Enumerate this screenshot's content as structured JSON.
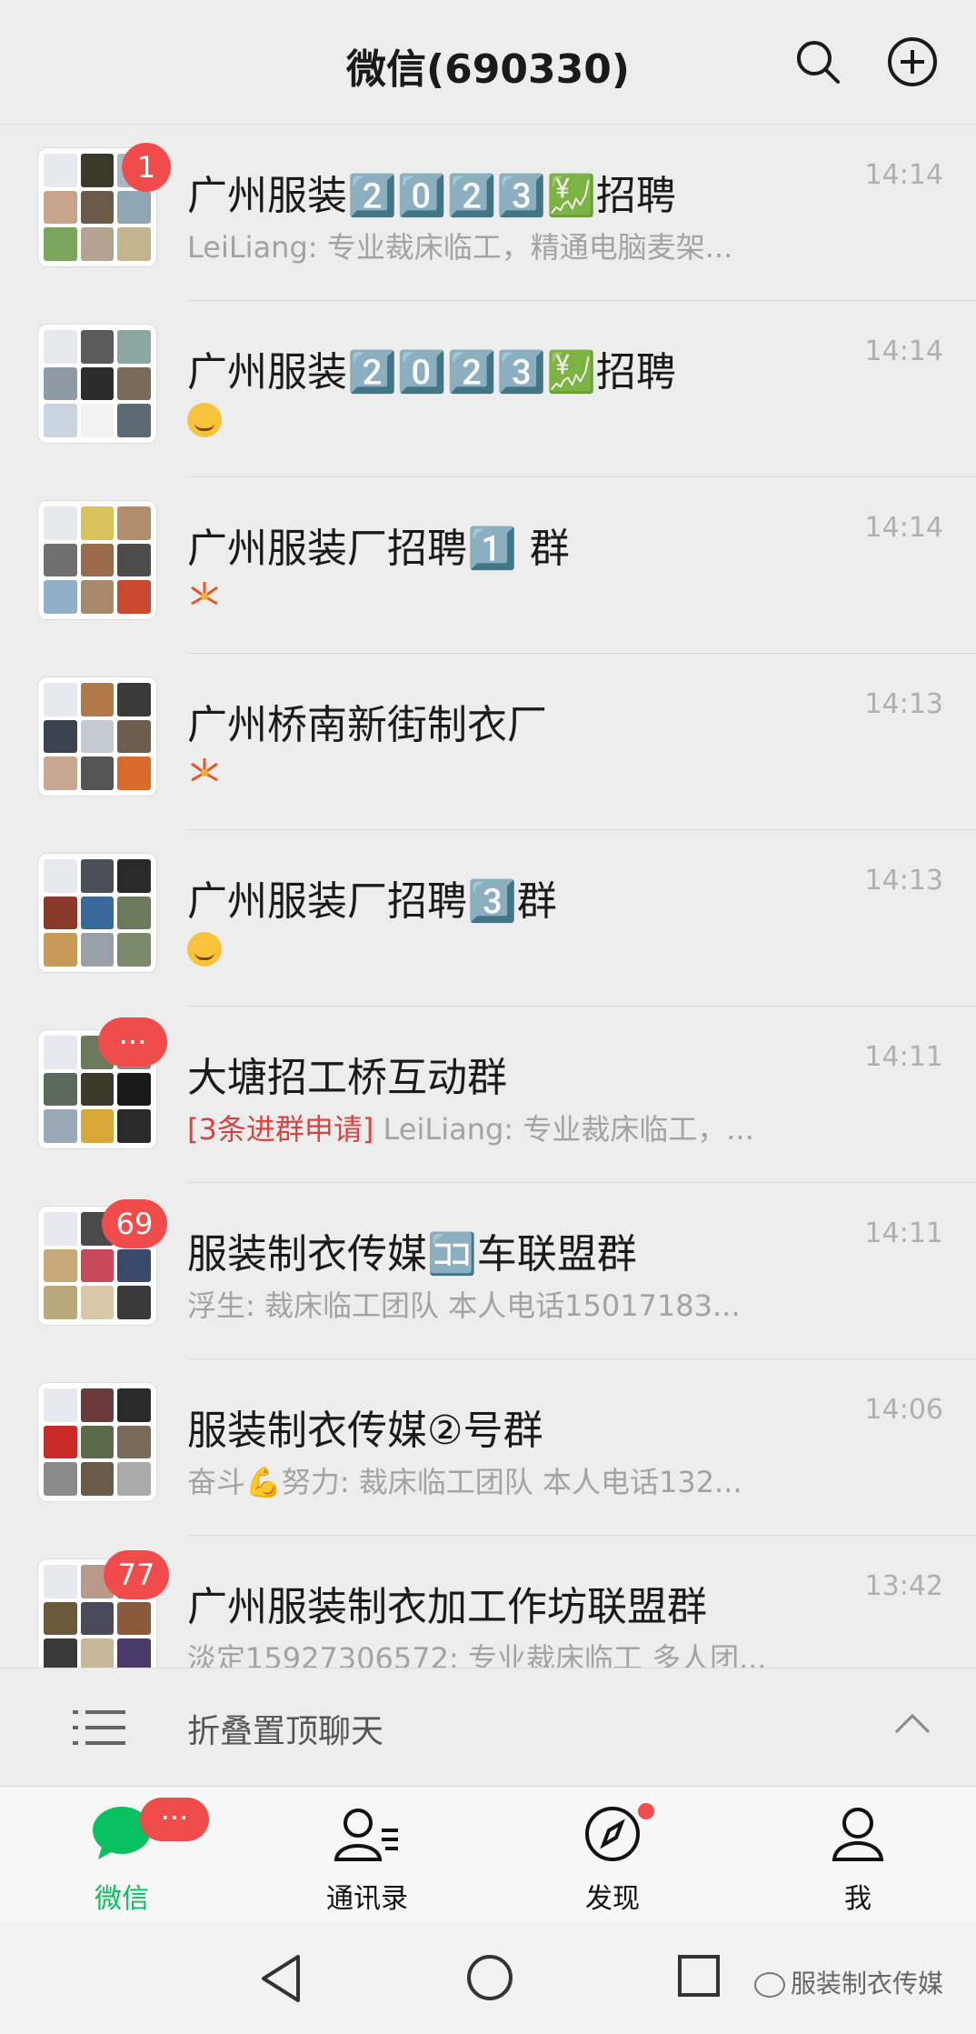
{
  "header": {
    "title": "微信(690330)"
  },
  "chats": [
    {
      "name": "广州服装2️⃣0️⃣2️⃣3️⃣💹招聘",
      "time": "14:14",
      "preview": "LeiLiang: 专业裁床临工，精通电脑麦架...",
      "badge": "1"
    },
    {
      "name": "广州服装2️⃣0️⃣2️⃣3️⃣💹招聘",
      "time": "14:14",
      "preview": "",
      "badge": ""
    },
    {
      "name": "广州服装厂招聘1️⃣ 群",
      "time": "14:14",
      "preview": "",
      "badge": ""
    },
    {
      "name": "广州桥南新街制衣厂",
      "time": "14:13",
      "preview": "",
      "badge": ""
    },
    {
      "name": "广州服装厂招聘3️⃣群",
      "time": "14:13",
      "preview": "",
      "badge": ""
    },
    {
      "name": "大塘招工桥互动群",
      "time": "14:11",
      "preview_warn": "[3条进群申请]",
      "preview": " LeiLiang: 专业裁床临工，...",
      "badge": "···"
    },
    {
      "name": "服装制衣传媒🈁车联盟群",
      "time": "14:11",
      "preview": "浮生: 裁床临工团队 本人电话15017183...",
      "badge": "69"
    },
    {
      "name": "服装制衣传媒②号群",
      "time": "14:06",
      "preview": "奋斗💪努力: 裁床临工团队 本人电话132...",
      "badge": ""
    },
    {
      "name": "广州服装制衣加工作坊联盟群",
      "time": "13:42",
      "preview": "淡定15927306572: 专业裁床临工 多人团...",
      "badge": "77"
    }
  ],
  "folder": {
    "label": "折叠置顶聊天"
  },
  "tabs": [
    {
      "label": "微信",
      "badge": "···"
    },
    {
      "label": "通讯录"
    },
    {
      "label": "发现"
    },
    {
      "label": "我"
    }
  ],
  "watermark": "服装制衣传媒",
  "colors": {
    "accent": "#07c160",
    "badge": "#f14c4c",
    "warn": "#d64541"
  }
}
